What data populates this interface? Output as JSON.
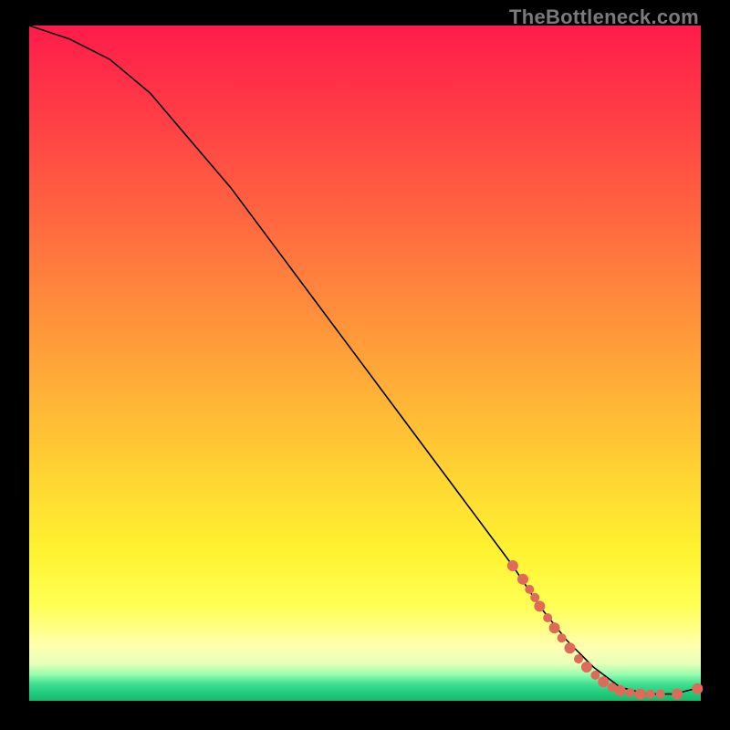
{
  "watermark": "TheBottleneck.com",
  "colors": {
    "background": "#000000",
    "dot": "#e06a5a",
    "curve": "#000000"
  },
  "chart_data": {
    "type": "line",
    "title": "",
    "xlabel": "",
    "ylabel": "",
    "xlim": [
      0,
      100
    ],
    "ylim": [
      0,
      100
    ],
    "series": [
      {
        "name": "curve",
        "x": [
          0,
          6,
          12,
          18,
          24,
          30,
          36,
          42,
          48,
          54,
          60,
          66,
          72,
          76,
          80,
          84,
          88,
          92,
          96,
          100
        ],
        "y": [
          100,
          98,
          95,
          90,
          83,
          76,
          68,
          60,
          52,
          44,
          36,
          28,
          20,
          14,
          9,
          5,
          2,
          1,
          1,
          2
        ]
      }
    ],
    "markers": [
      {
        "x": 72.0,
        "y": 20.0,
        "r": 6
      },
      {
        "x": 73.5,
        "y": 18.0,
        "r": 6
      },
      {
        "x": 74.5,
        "y": 16.5,
        "r": 5
      },
      {
        "x": 75.3,
        "y": 15.3,
        "r": 5
      },
      {
        "x": 76.0,
        "y": 14.0,
        "r": 6
      },
      {
        "x": 77.2,
        "y": 12.3,
        "r": 5
      },
      {
        "x": 78.2,
        "y": 10.8,
        "r": 6
      },
      {
        "x": 79.3,
        "y": 9.3,
        "r": 5
      },
      {
        "x": 80.5,
        "y": 7.8,
        "r": 6
      },
      {
        "x": 81.8,
        "y": 6.2,
        "r": 5
      },
      {
        "x": 83.0,
        "y": 5.0,
        "r": 6
      },
      {
        "x": 84.3,
        "y": 3.8,
        "r": 5
      },
      {
        "x": 85.5,
        "y": 2.8,
        "r": 6
      },
      {
        "x": 86.8,
        "y": 2.0,
        "r": 5
      },
      {
        "x": 88.0,
        "y": 1.5,
        "r": 6
      },
      {
        "x": 89.5,
        "y": 1.2,
        "r": 5
      },
      {
        "x": 91.0,
        "y": 1.0,
        "r": 6
      },
      {
        "x": 92.5,
        "y": 1.0,
        "r": 5
      },
      {
        "x": 94.0,
        "y": 1.0,
        "r": 5
      },
      {
        "x": 96.5,
        "y": 1.0,
        "r": 6
      },
      {
        "x": 99.5,
        "y": 1.8,
        "r": 6
      }
    ]
  }
}
